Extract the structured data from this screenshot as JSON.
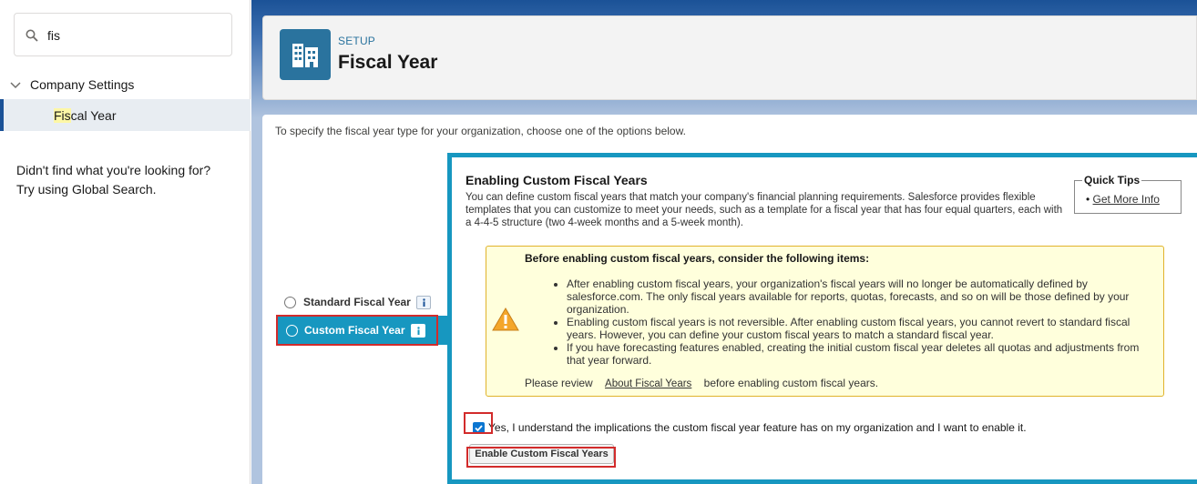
{
  "sidebar": {
    "search_value": "fis",
    "tree_parent_label": "Company Settings",
    "tree_child_highlight": "Fis",
    "tree_child_rest": "cal Year",
    "not_found_line1": "Didn't find what you're looking for?",
    "not_found_line2": "Try using Global Search."
  },
  "header": {
    "setup_label": "SETUP",
    "title": "Fiscal Year"
  },
  "content": {
    "intro": "To specify the fiscal year type for your organization, choose one of the options below.",
    "options": {
      "standard_label": "Standard Fiscal Year",
      "custom_label": "Custom Fiscal Year"
    },
    "panel": {
      "title": "Enabling Custom Fiscal Years",
      "description": "You can define custom fiscal years that match your company's financial planning requirements. Salesforce provides flexible templates that you can customize to meet your needs, such as a template for a fiscal year that has four equal quarters, each with a 4-4-5 structure (two 4-week months and a 5-week month).",
      "quick_tips_title": "Quick Tips",
      "quick_tips_link": "Get More Info",
      "warning_title": "Before enabling custom fiscal years, consider the following items:",
      "warning_items": [
        "After enabling custom fiscal years, your organization's fiscal years will no longer be automatically defined by salesforce.com. The only fiscal years available for reports, quotas, forecasts, and so on will be those defined by your organization.",
        "Enabling custom fiscal years is not reversible. After enabling custom fiscal years, you cannot revert to standard fiscal years. However, you can define your custom fiscal years to match a standard fiscal year.",
        "If you have forecasting features enabled, creating the initial custom fiscal year deletes all quotas and adjustments from that year forward."
      ],
      "warning_foot_before": "Please review",
      "warning_foot_link": "About Fiscal Years",
      "warning_foot_after": "before enabling custom fiscal years.",
      "ack_label": "Yes, I understand the implications the custom fiscal year feature has on my organization and I want to enable it.",
      "ack_checked": true,
      "enable_button": "Enable Custom Fiscal Years"
    }
  },
  "colors": {
    "brand_blue": "#1797c0",
    "header_icon": "#2a739e",
    "annotation_red": "#d22b2b",
    "warning_bg": "#ffffdc"
  }
}
